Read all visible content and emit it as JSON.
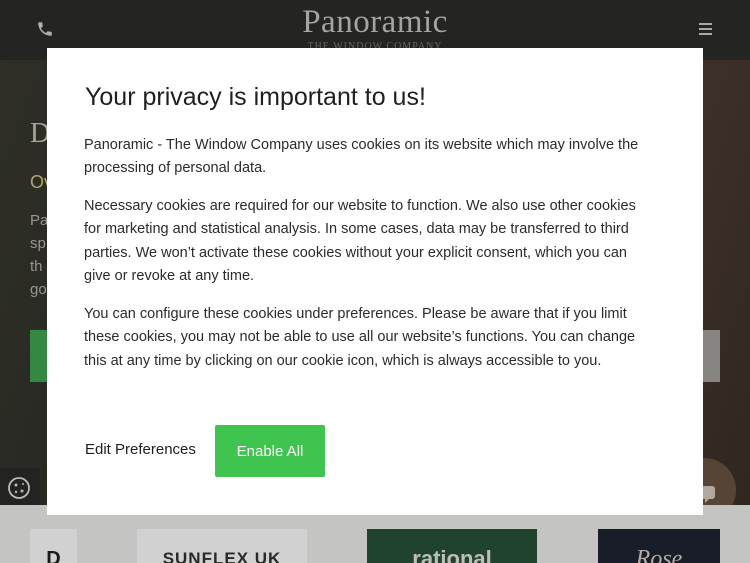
{
  "header": {
    "logo_title": "Panoramic",
    "logo_subtitle": "THE WINDOW COMPANY",
    "phone_icon": "phone-icon",
    "menu_icon": "hamburger-menu-icon"
  },
  "hero": {
    "heading_fragment": "D",
    "subheading_fragment": "Ov",
    "paragraph_fragments": [
      "Pa",
      "sp",
      "th",
      "go"
    ]
  },
  "brands": [
    {
      "name": "brand-logo-partial",
      "text": "D"
    },
    {
      "name": "brand-logo-sunflex",
      "text": "SUNFLEX UK"
    },
    {
      "name": "brand-logo-rational",
      "text": "rational"
    },
    {
      "name": "brand-logo-rose",
      "text": "Rose"
    }
  ],
  "privacy_modal": {
    "title": "Your privacy is important to us!",
    "paragraph_1": "Panoramic - The Window Company uses cookies on its website which may involve the processing of personal data.",
    "paragraph_2": "Necessary cookies are required for our website to function. We also use other cookies for marketing and statistical analysis. In some cases, data may be transferred to third parties. We won’t activate these cookies without your explicit consent, which you can give or revoke at any time.",
    "paragraph_3": "You can configure these cookies under preferences. Please be aware that if you limit these cookies, you may not be able to use all our website’s functions. You can change this at any time by clicking on our cookie icon, which is always accessible to you.",
    "edit_preferences_label": "Edit Preferences",
    "enable_all_label": "Enable All"
  },
  "colors": {
    "accent_green": "#3ec44f",
    "header_bg": "#2c2c2a"
  },
  "floating": {
    "cookie_icon": "cookie-icon",
    "chat_icon": "chat-icon"
  }
}
